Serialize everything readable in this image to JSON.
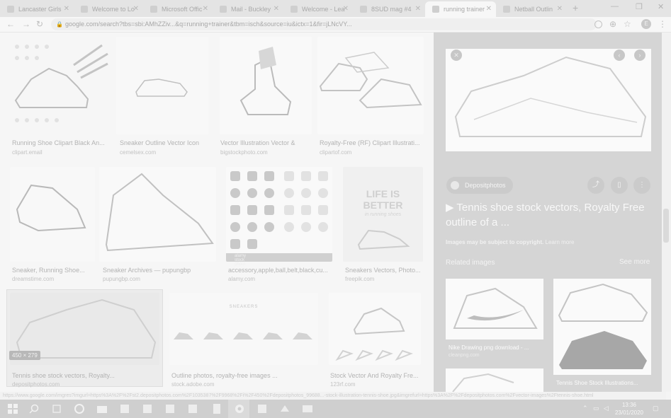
{
  "browser": {
    "tabs": [
      {
        "title": "Lancaster Girls",
        "active": false
      },
      {
        "title": "Welcome to Lo",
        "active": false
      },
      {
        "title": "Microsoft Offic",
        "active": false
      },
      {
        "title": "Mail - Buckley",
        "active": false
      },
      {
        "title": "Welcome - Lea",
        "active": false
      },
      {
        "title": "8SUD mag #4",
        "active": false
      },
      {
        "title": "running trainer",
        "active": true
      },
      {
        "title": "Netball Outlin",
        "active": false
      }
    ],
    "new_tab": "+",
    "url": "google.com/search?tbs=sbi:AMhZZiv...&q=running+trainer&tbm=isch&source=iu&ictx=1&fir=jLNcVY...",
    "profile_initial": "E"
  },
  "grid": {
    "rows": [
      [
        {
          "title": "Running Shoe Clipart Black An...",
          "source": "clipart.email"
        },
        {
          "title": "Sneaker Outline Vector Icon",
          "source": "cemelsex.com"
        },
        {
          "title": "Vector Illustration Vector &",
          "source": "bigstockphoto.com"
        },
        {
          "title": "Royalty-Free (RF) Clipart Illustrati...",
          "source": "clipartof.com"
        }
      ],
      [
        {
          "title": "Sneaker, Running Shoe...",
          "source": "dreamstime.com"
        },
        {
          "title": "Sneaker Archives — pupungbp",
          "source": "pupungbp.com"
        },
        {
          "title": "accessory,apple,ball,belt,black,cu...",
          "source": "alamy.com"
        },
        {
          "title": "Sneakers Vectors, Photo...",
          "source": "freepik.com"
        }
      ],
      [
        {
          "title": "Tennis shoe stock vectors, Royalty...",
          "source": "depositphotos.com"
        },
        {
          "title": "Outline photos, royalty-free images ...",
          "source": "stock.adobe.com"
        },
        {
          "title": "Stock Vector And Royalty Fre...",
          "source": "123rf.com"
        }
      ]
    ],
    "selected_dims": "450 × 279",
    "alamy_badge": "alamy stock photo",
    "sneakers_heading": "SNEAKERS",
    "poster_text": [
      "LIFE IS",
      "BETTER",
      "in running shoes"
    ]
  },
  "panel": {
    "source_chip": "Depositphotos",
    "title": "▶ Tennis shoe stock vectors, Royalty Free outline of a ...",
    "copyright_notice": "Images may be subject to copyright.",
    "learn_more": "Learn more",
    "related_heading": "Related images",
    "see_more": "See more",
    "related": [
      {
        "title": "Nike Drawing png download - ...",
        "source": "cleanpng.com"
      },
      {
        "title": "Tennis Shoe Stock Illustrations...",
        "source": ""
      }
    ]
  },
  "status_bar_url": "https://www.google.com/imgres?imgurl=https%3A%2F%2Fst2.depositphotos.com%2F1035387%2F9968%2Fi%2F450%2Fdepositphotos_99688...-stock-illustration-tennis-shoe.jpg&imgrefurl=https%3A%2F%2Fdepositphotos.com%2Fvector-images%2Ftennis-shoe.html",
  "taskbar": {
    "time": "13:36",
    "date": "23/01/2020"
  }
}
